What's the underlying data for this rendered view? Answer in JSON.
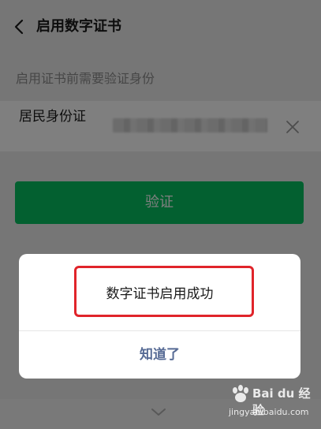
{
  "nav": {
    "title": "启用数字证书",
    "back_icon": "chevron-left-icon"
  },
  "hint": "启用证书前需要验证身份",
  "id_field": {
    "label": "居民身份证",
    "value_masked": true,
    "clear_icon": "close-icon"
  },
  "verify_button": {
    "label": "验证",
    "color": "#07c160"
  },
  "dialog": {
    "message": "数字证书启用成功",
    "ok_label": "知道了",
    "ok_color": "#576b95",
    "highlight_color": "#e0242a"
  },
  "watermark": {
    "brand": "Bai du 经验",
    "url": "jingyan.baidu.com"
  }
}
